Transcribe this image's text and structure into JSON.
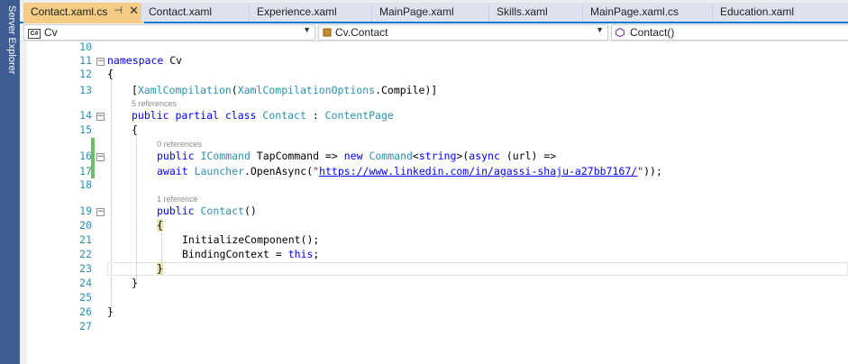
{
  "side_panel": {
    "label": "Server Explorer"
  },
  "tabs": [
    {
      "label": "Contact.xaml.cs",
      "active": true
    },
    {
      "label": "Contact.xaml"
    },
    {
      "label": "Experience.xaml"
    },
    {
      "label": "MainPage.xaml"
    },
    {
      "label": "Skills.xaml"
    },
    {
      "label": "MainPage.xaml.cs"
    },
    {
      "label": "Education.xaml"
    }
  ],
  "tab_icons": {
    "pin": "pin-icon",
    "close": "close-icon"
  },
  "navbar": {
    "project": "Cv",
    "class": "Cv.Contact",
    "member": "Contact()"
  },
  "line_numbers": [
    "10",
    "11",
    "12",
    "13",
    "14",
    "15",
    "16",
    "17",
    "18",
    "19",
    "20",
    "21",
    "22",
    "23",
    "24",
    "25",
    "26",
    "27"
  ],
  "code": {
    "l11_kw": "namespace",
    "l11_name": " Cv",
    "l12": "{",
    "l13_open": "[",
    "l13_t1": "XamlCompilation",
    "l13_p": "(",
    "l13_t2": "XamlCompilationOptions",
    "l13_rest": ".Compile)]",
    "lens_14": "5 references",
    "l14_kw": "public partial class",
    "l14_sp": " ",
    "l14_t1": "Contact",
    "l14_colon": " : ",
    "l14_t2": "ContentPage",
    "l15": "{",
    "lens_16": "0 references",
    "l16_kw1": "public",
    "l16_sp1": " ",
    "l16_t1": "ICommand",
    "l16_mid": " TapCommand => ",
    "l16_kw2": "new",
    "l16_sp2": " ",
    "l16_t2": "Command",
    "l16_lt": "<",
    "l16_kw3": "string",
    "l16_gt": ">(",
    "l16_kw4": "async",
    "l16_end": " (url) =>",
    "l17_kw": "await",
    "l17_sp": " ",
    "l17_t": "Launcher",
    "l17_mid": ".OpenAsync(",
    "l17_q1": "\"",
    "l17_url": "https://www.linkedin.com/in/agassi-shaju-a27bb7167/",
    "l17_q2": "\"",
    "l17_end": "));",
    "lens_19": "1 reference",
    "l19_kw": "public",
    "l19_sp": " ",
    "l19_t": "Contact",
    "l19_end": "()",
    "l20": "{",
    "l21": "InitializeComponent();",
    "l22_a": "BindingContext = ",
    "l22_kw": "this",
    "l22_b": ";",
    "l23": "}",
    "l24": "}",
    "l26": "}"
  },
  "colors": {
    "keyword": "#0000ff",
    "type": "#2b91af",
    "string": "#a31515",
    "active_tab": "#f5cc84",
    "side_strip": "#3e5d92",
    "change_bar": "#6dc067"
  }
}
